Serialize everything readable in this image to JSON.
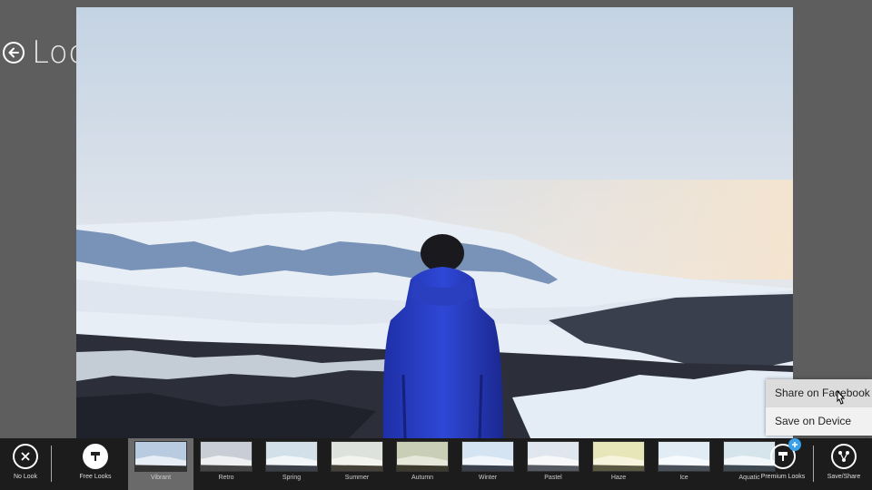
{
  "header": {
    "title": "Looks"
  },
  "share_menu": {
    "items": [
      {
        "label": "Share on Facebook"
      },
      {
        "label": "Save on Device"
      }
    ]
  },
  "appbar": {
    "no_look_label": "No Look",
    "free_looks_label": "Free Looks",
    "premium_looks_label": "Premium Looks",
    "save_share_label": "Save/Share",
    "looks": [
      {
        "label": "Vibrant",
        "tint": "#b8cbe0",
        "selected": true
      },
      {
        "label": "Retro",
        "tint": "#c8cdd6"
      },
      {
        "label": "Spring",
        "tint": "#d2e0ea"
      },
      {
        "label": "Summer",
        "tint": "#dde2dc"
      },
      {
        "label": "Autumn",
        "tint": "#c9ceb6"
      },
      {
        "label": "Winter",
        "tint": "#d4e4f2"
      },
      {
        "label": "Pastel",
        "tint": "#dfe6ee"
      },
      {
        "label": "Haze",
        "tint": "#e6e6b8"
      },
      {
        "label": "Ice",
        "tint": "#e2ecf4"
      },
      {
        "label": "Aquatic",
        "tint": "#d6e4ec"
      }
    ]
  },
  "colors": {
    "appbar_bg": "#1c1c1c",
    "badge": "#3aa0e8",
    "menu_bg": "#f1f1f1"
  }
}
